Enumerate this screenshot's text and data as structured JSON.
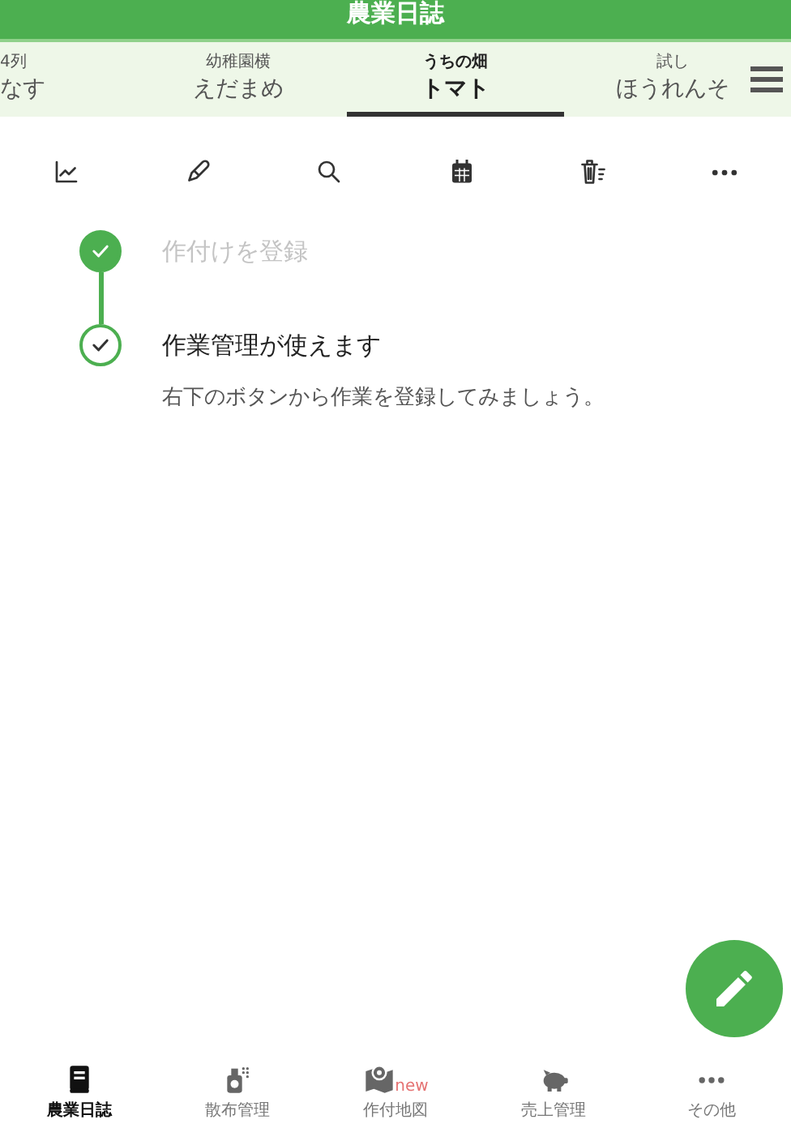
{
  "app_bar": {
    "title": "農業日誌"
  },
  "tabs": [
    {
      "field": "4列",
      "crop": "なす",
      "selected": false
    },
    {
      "field": "幼稚園横",
      "crop": "えだまめ",
      "selected": false
    },
    {
      "field": "うちの畑",
      "crop": "トマト",
      "selected": true
    },
    {
      "field": "試し",
      "crop": "ほうれんそ",
      "selected": false
    }
  ],
  "toolbar": [
    {
      "kind": "chart"
    },
    {
      "kind": "pen"
    },
    {
      "kind": "search"
    },
    {
      "kind": "calendar"
    },
    {
      "kind": "delete"
    },
    {
      "kind": "more"
    }
  ],
  "steps": [
    {
      "title": "作付けを登録",
      "kind": "completed"
    },
    {
      "title": "作業管理が使えます",
      "kind": "current",
      "description": "右下のボタンから作業を登録してみましょう。"
    }
  ],
  "bottom_nav": [
    {
      "kind": "diary",
      "label": "農業日誌",
      "selected": true
    },
    {
      "kind": "spray",
      "label": "散布管理",
      "selected": false
    },
    {
      "kind": "map",
      "label": "作付地図",
      "selected": false,
      "badge": "new"
    },
    {
      "kind": "sales",
      "label": "売上管理",
      "selected": false
    },
    {
      "kind": "other",
      "label": "その他",
      "selected": false
    }
  ]
}
